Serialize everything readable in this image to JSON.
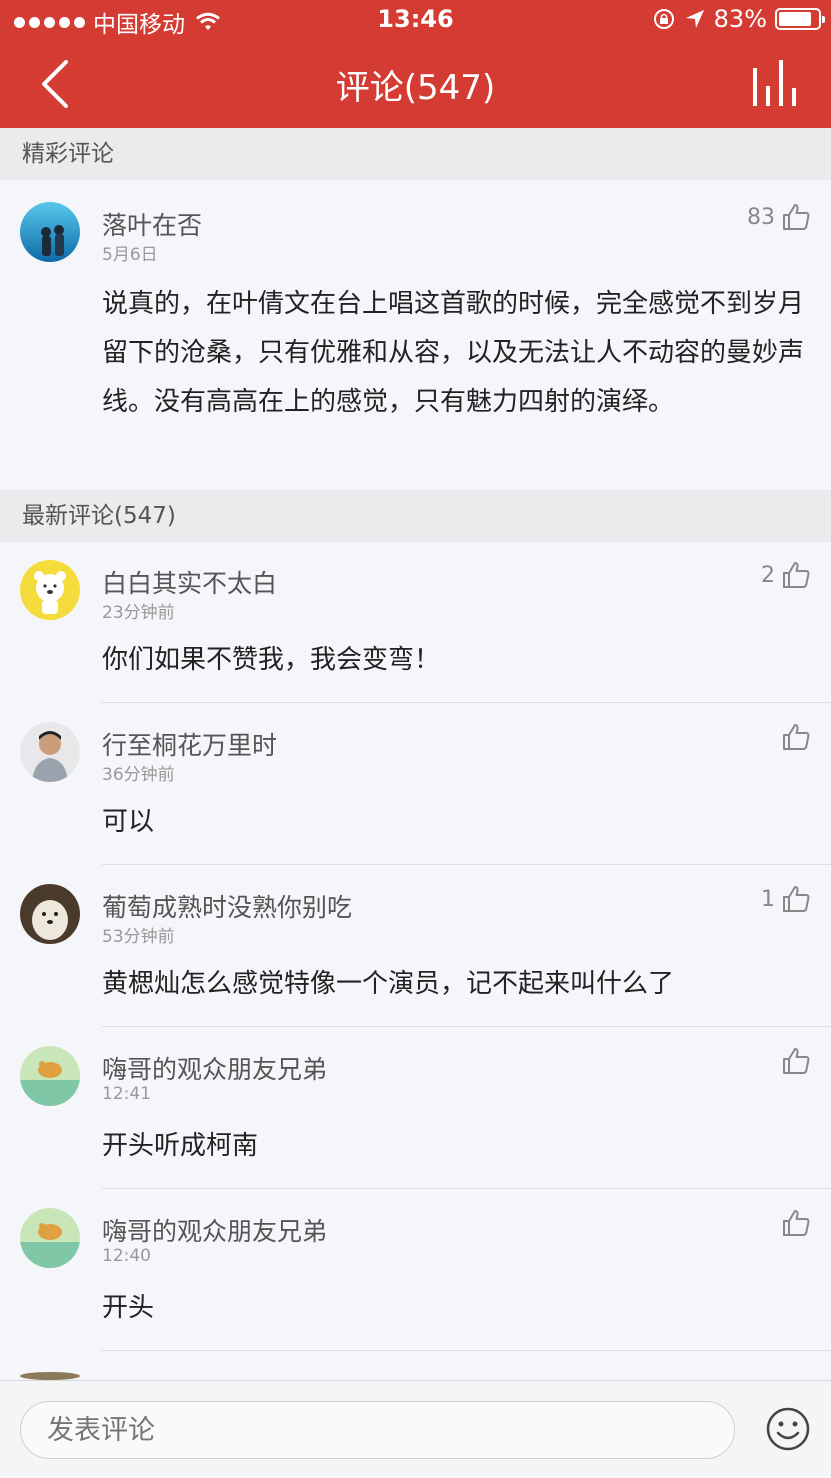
{
  "status_bar": {
    "carrier": "中国移动",
    "time": "13:46",
    "battery_text": "83%",
    "battery_level": 0.83
  },
  "nav": {
    "title": "评论(547)"
  },
  "sections": {
    "featured_title": "精彩评论",
    "latest_title": "最新评论(547)"
  },
  "featured_comment": {
    "username": "落叶在否",
    "time": "5月6日",
    "likes": "83",
    "text": "说真的，在叶倩文在台上唱这首歌的时候，完全感觉不到岁月留下的沧桑，只有优雅和从容，以及无法让人不动容的曼妙声线。没有高高在上的感觉，只有魅力四射的演绎。"
  },
  "latest_comments": [
    {
      "username": "白白其实不太白",
      "time": "23分钟前",
      "likes": "2",
      "text": "你们如果不赞我，我会变弯！"
    },
    {
      "username": "行至桐花万里时",
      "time": "36分钟前",
      "likes": "",
      "text": "可以"
    },
    {
      "username": "葡萄成熟时没熟你别吃",
      "time": "53分钟前",
      "likes": "1",
      "text": "黄楒灿怎么感觉特像一个演员，记不起来叫什么了"
    },
    {
      "username": "嗨哥的观众朋友兄弟",
      "time": "12:41",
      "likes": "",
      "text": "开头听成柯南"
    },
    {
      "username": "嗨哥的观众朋友兄弟",
      "time": "12:40",
      "likes": "",
      "text": "开头"
    }
  ],
  "bottom_bar": {
    "input_placeholder": "发表评论"
  },
  "colors": {
    "brand_red": "#d43c33"
  },
  "icons": [
    "back-chevron-icon",
    "chart-bars-icon",
    "thumbs-up-icon",
    "emoji-smile-icon",
    "wifi-icon",
    "lock-rotation-icon",
    "location-arrow-icon",
    "battery-icon"
  ]
}
